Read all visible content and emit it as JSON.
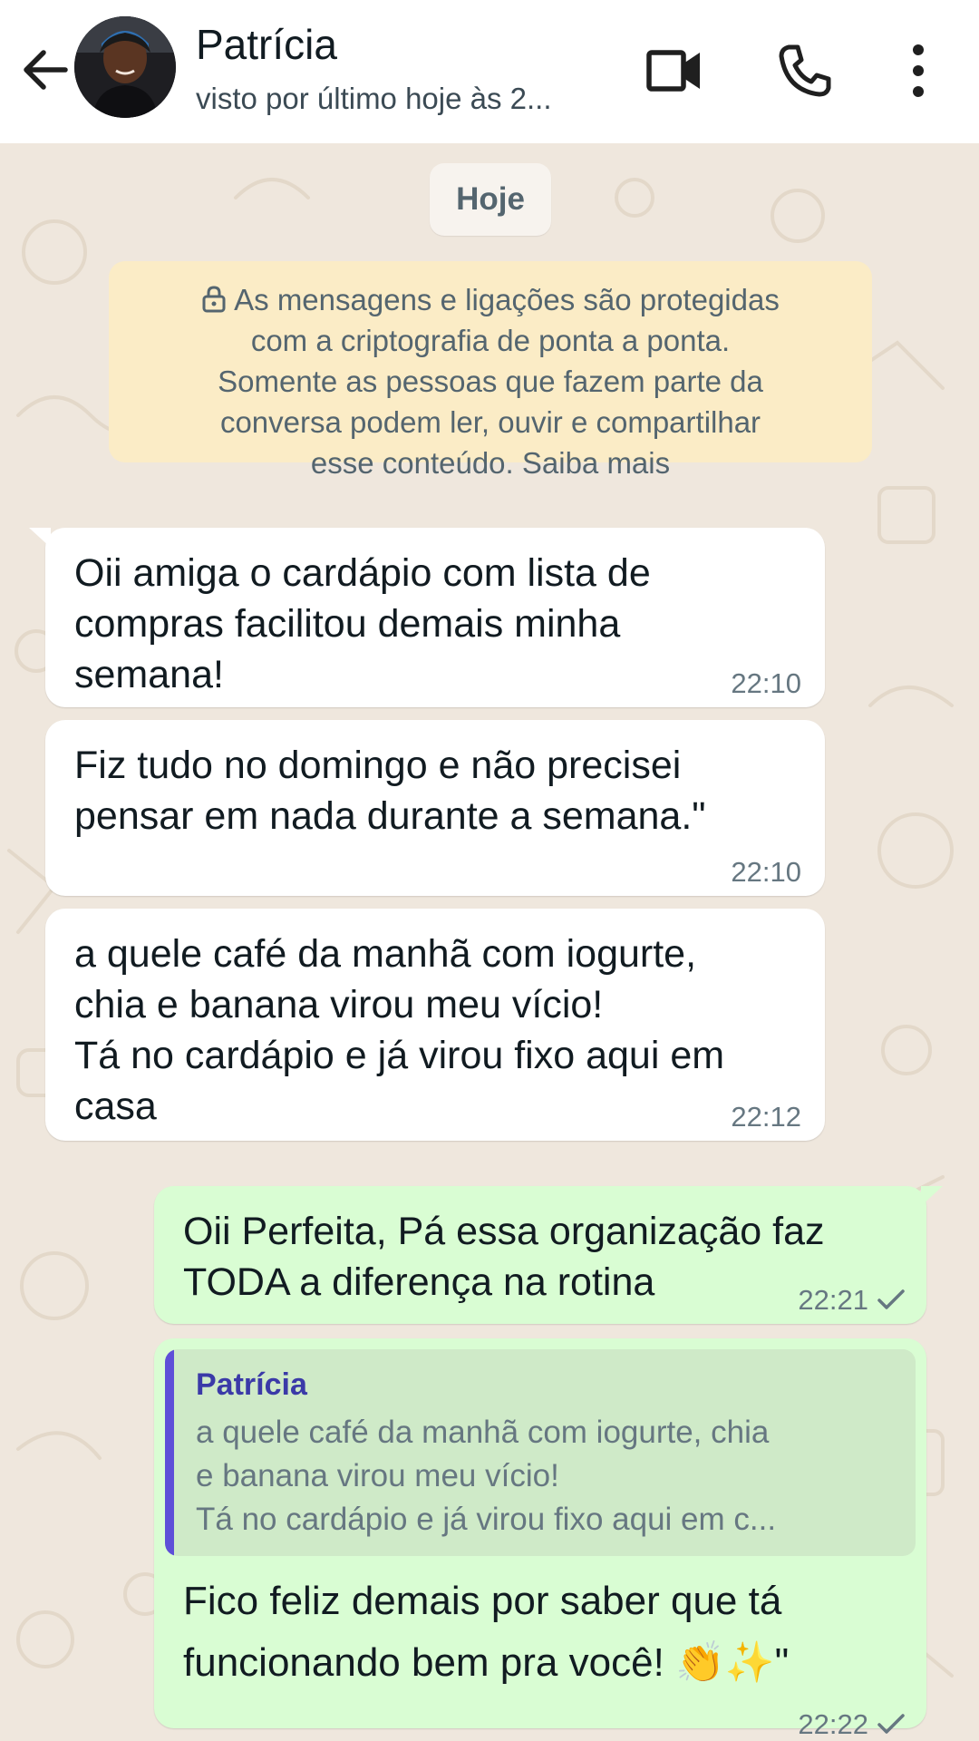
{
  "header": {
    "contact_name": "Patrícia",
    "last_seen": "visto por último hoje às 2...",
    "icons": [
      "back-arrow-icon",
      "video-call-icon",
      "phone-icon",
      "more-options-icon"
    ]
  },
  "chat": {
    "date_chip": "Hoje",
    "encryption_notice": "As mensagens e ligações são protegidas\ncom a criptografia de ponta a ponta.\nSomente as pessoas que fazem parte da\nconversa podem ler, ouvir e compartilhar\nesse conteúdo. Saiba mais",
    "messages": [
      {
        "direction": "incoming",
        "text": "Oii amiga o cardápio com lista de\ncompras facilitou demais minha\nsemana!",
        "time": "22:10"
      },
      {
        "direction": "incoming",
        "text": "Fiz tudo no domingo e não precisei\npensar em nada durante a semana.\"",
        "time": "22:10"
      },
      {
        "direction": "incoming",
        "text": "a quele café da manhã com iogurte,\nchia e banana virou meu vício!\nTá no cardápio e já virou fixo aqui em\ncasa",
        "time": "22:12"
      },
      {
        "direction": "outgoing",
        "text": "Oii Perfeita, Pá essa organização faz\nTODA a diferença na rotina",
        "time": "22:21",
        "status": "sent"
      },
      {
        "direction": "outgoing",
        "quote": {
          "author": "Patrícia",
          "text": "a quele café da manhã com iogurte, chia\ne banana virou meu vício!\nTá no cardápio e já virou fixo aqui em c..."
        },
        "text": "Fico feliz demais por saber que tá\nfuncionando bem pra você! 👏✨\"",
        "time": "22:22",
        "status": "sent"
      }
    ]
  },
  "colors": {
    "incoming_bubble": "#ffffff",
    "outgoing_bubble": "#d9fdd3",
    "encryption_notice_bg": "#fbecc6",
    "chat_background": "#efe7dd",
    "quote_bar": "#5e4fd8"
  }
}
